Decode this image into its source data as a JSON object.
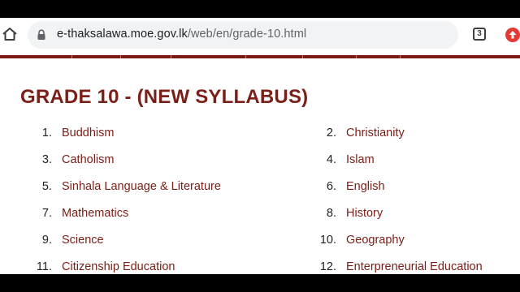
{
  "browser": {
    "url_domain": "e-thaksalawa.moe.gov.lk",
    "url_path": "/web/en/grade-10.html",
    "tab_count": "3",
    "icons": {
      "home": "home-icon",
      "lock": "lock-icon",
      "tabs": "tab-switcher-icon",
      "update": "update-available-icon"
    }
  },
  "page": {
    "title": "GRADE 10 - (NEW SYLLABUS)",
    "accent_color": "#7b2018",
    "subjects": [
      {
        "num": "1.",
        "name": "Buddhism"
      },
      {
        "num": "2.",
        "name": "Christianity"
      },
      {
        "num": "3.",
        "name": "Catholism"
      },
      {
        "num": "4.",
        "name": "Islam"
      },
      {
        "num": "5.",
        "name": "Sinhala Language & Literature"
      },
      {
        "num": "6.",
        "name": "English"
      },
      {
        "num": "7.",
        "name": "Mathematics"
      },
      {
        "num": "8.",
        "name": "History"
      },
      {
        "num": "9.",
        "name": "Science"
      },
      {
        "num": "10.",
        "name": "Geography"
      },
      {
        "num": "11.",
        "name": "Citizenship Education"
      },
      {
        "num": "12.",
        "name": "Enterpreneurial Education"
      }
    ]
  }
}
